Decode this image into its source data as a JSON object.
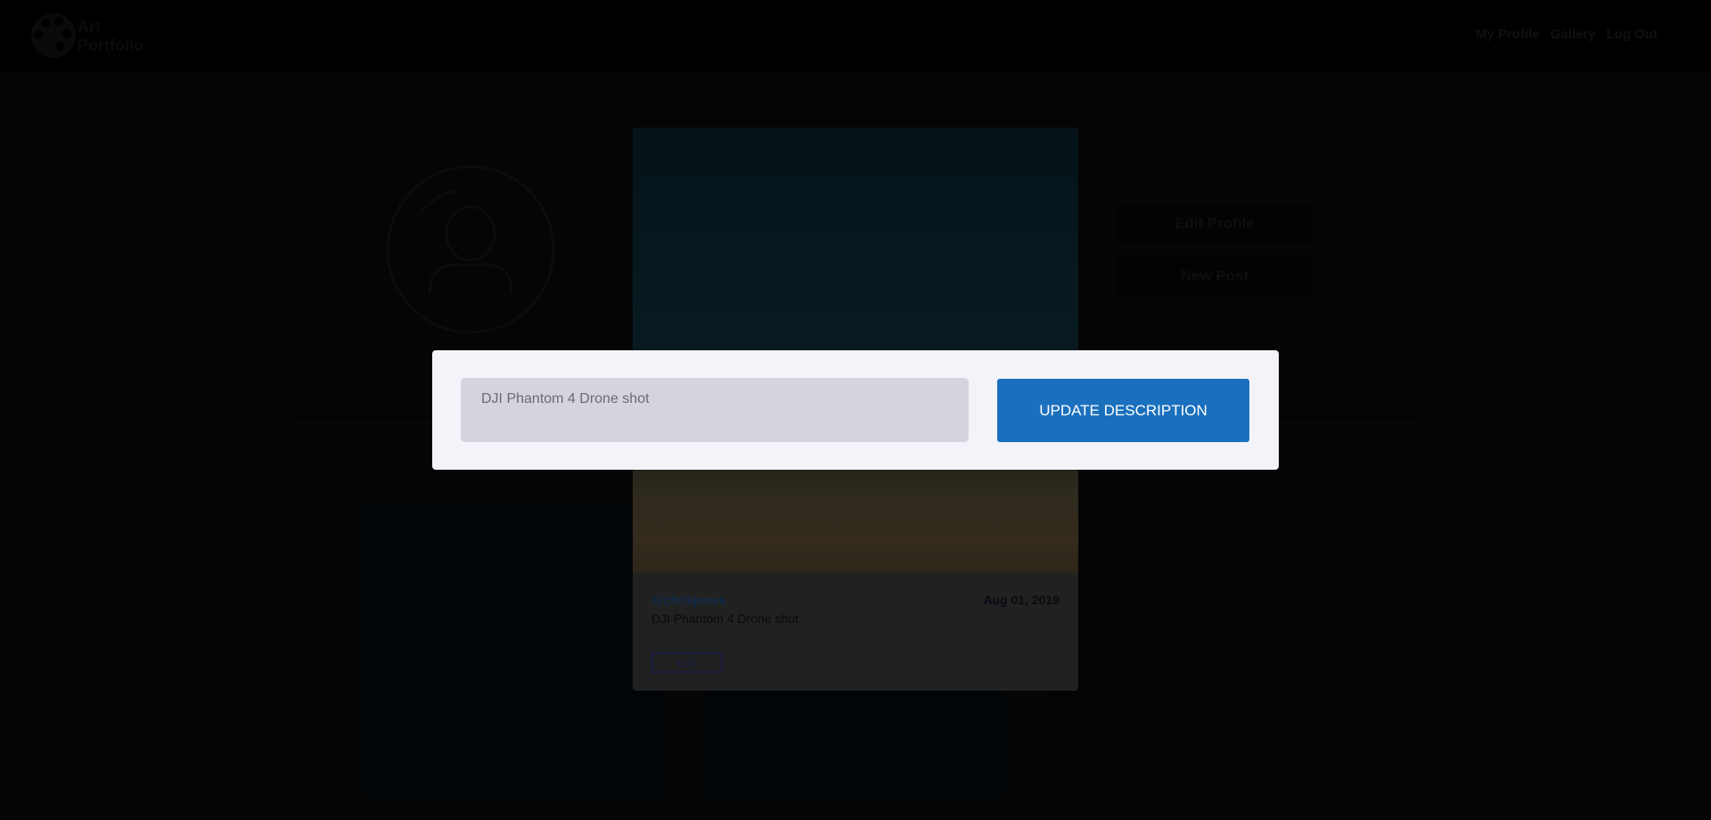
{
  "header": {
    "logo_text_1": "Art",
    "logo_text_2": "Portfolio",
    "nav": [
      "My Profile",
      "Gallery",
      "Log Out"
    ]
  },
  "profile": {
    "edit_profile": "Edit Profile",
    "new_post": "New Post"
  },
  "post": {
    "username": "@chrisjones",
    "date": "Aug 01, 2019",
    "description": "DJI Phantom 4 Drone shot",
    "edit_label": "Edit"
  },
  "modal": {
    "input_value": "DJI Phantom 4 Drone shot",
    "button_label": "UPDATE DESCRIPTION"
  },
  "colors": {
    "accent": "#1b70bd",
    "modal_bg": "#f3f4f9",
    "input_bg": "#d4d4df"
  }
}
